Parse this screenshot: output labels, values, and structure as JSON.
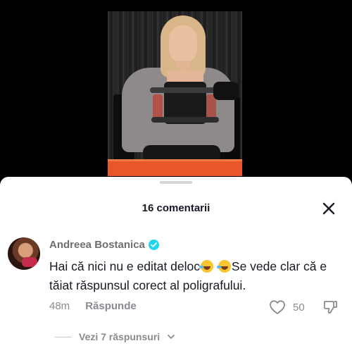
{
  "sheet": {
    "title": "16 comentarii"
  },
  "comment": {
    "username": "Andreea Bostanica",
    "text_before": "Hai că nici nu e editat deloc",
    "text_after": "Se vede clar că e tăiat răspunsul corect al poligrafului.",
    "emoji_count": 2,
    "time": "48m",
    "reply_label": "Răspunde",
    "like_count": "50",
    "view_replies": "Vezi 7 răspunsuri"
  },
  "colors": {
    "accent_verified": "#20d5ec",
    "video_bar": "#e8562a",
    "text_primary": "#161823",
    "text_secondary": "#8a8b91"
  },
  "icons": [
    "close-icon",
    "verified-badge-icon",
    "heart-icon",
    "dislike-icon",
    "chevron-down-icon"
  ]
}
